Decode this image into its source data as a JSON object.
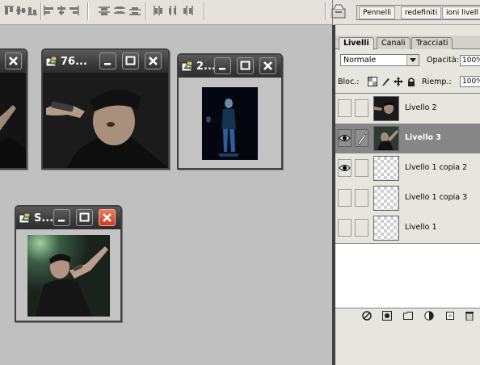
{
  "options_bar": {
    "tools": [
      "align-top-icon",
      "align-vcenter-icon",
      "align-bottom-icon",
      "align-left-icon",
      "align-hcenter-icon",
      "align-right-icon",
      "distribute-top-icon",
      "distribute-vcenter-icon",
      "distribute-bottom-icon",
      "distribute-left-icon",
      "distribute-hcenter-icon",
      "distribute-right-icon"
    ],
    "palette_well_tabs": [
      "Pennelli",
      "redefiniti",
      "ioni livell"
    ]
  },
  "documents": [
    {
      "title": "",
      "icon": "photoshop-doc-icon"
    },
    {
      "title": "76...",
      "icon": "photoshop-doc-icon"
    },
    {
      "title": "2...",
      "icon": "photoshop-doc-icon"
    },
    {
      "title": "S...",
      "icon": "photoshop-doc-icon"
    }
  ],
  "layers_panel": {
    "tabs": [
      "Livelli",
      "Canali",
      "Tracciati"
    ],
    "active_tab": "Livelli",
    "blend_mode": "Normale",
    "opacity_label": "Opacità:",
    "opacity_value": "100%",
    "lock_label": "Bloc.:",
    "fill_label": "Riemp.:",
    "fill_value": "100%",
    "layers": [
      {
        "name": "Livello 2",
        "visible": false,
        "selected": false,
        "thumb": "photo"
      },
      {
        "name": "Livello 3",
        "visible": true,
        "selected": true,
        "thumb": "photo"
      },
      {
        "name": "Livello 1 copia 2",
        "visible": true,
        "selected": false,
        "thumb": "transparent"
      },
      {
        "name": "Livello 1 copia 3",
        "visible": false,
        "selected": false,
        "thumb": "transparent"
      },
      {
        "name": "Livello 1",
        "visible": false,
        "selected": false,
        "thumb": "transparent"
      }
    ],
    "bottom_icons": [
      "link-layers-icon",
      "layer-style-icon",
      "layer-mask-icon",
      "new-group-icon",
      "adjustment-layer-icon",
      "new-layer-icon",
      "trash-icon"
    ]
  },
  "colors": {
    "titlebar": "#3a3a3a",
    "selected_layer": "#868686",
    "close_red": "#d2391d"
  }
}
